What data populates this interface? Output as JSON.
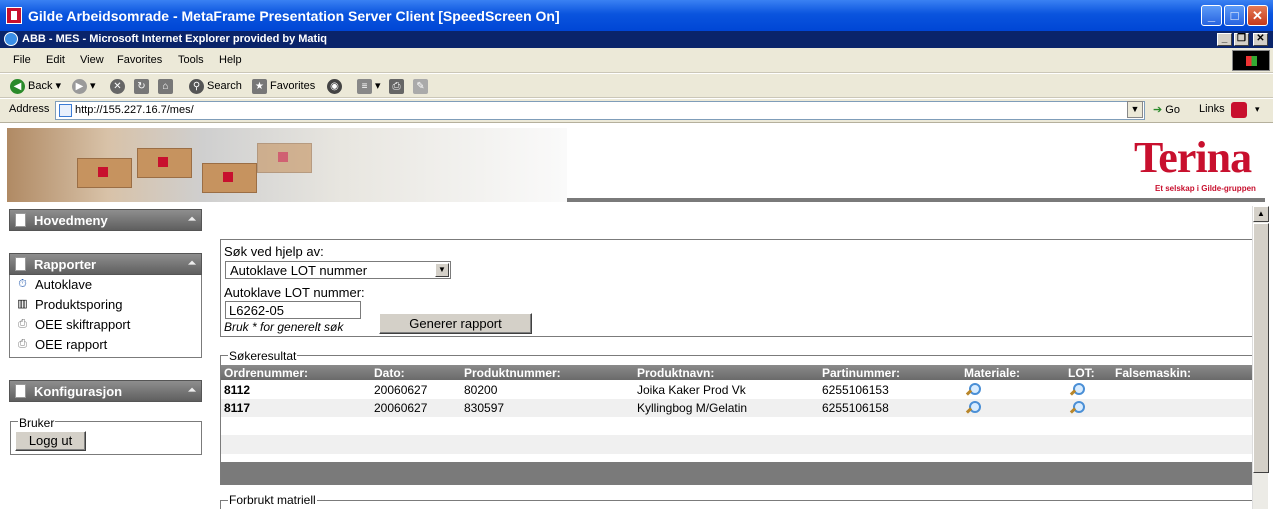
{
  "outer_window": {
    "title": "Gilde Arbeidsomrade - MetaFrame Presentation Server Client [SpeedScreen On]"
  },
  "browser": {
    "title": "ABB - MES - Microsoft Internet Explorer provided by Matiq",
    "menu": [
      "File",
      "Edit",
      "View",
      "Favorites",
      "Tools",
      "Help"
    ],
    "toolbar": {
      "back": "Back",
      "search": "Search",
      "favorites": "Favorites"
    },
    "address": {
      "label": "Address",
      "url": "http://155.227.16.7/mes/",
      "go": "Go",
      "links": "Links"
    }
  },
  "banner": {
    "logo_word": "Terina",
    "logo_tagline": "Et selskap i Gilde-gruppen"
  },
  "sidebar": {
    "hovedmeny": "Hovedmeny",
    "rapporter": {
      "title": "Rapporter",
      "items": [
        {
          "label": "Autoklave",
          "icon": "clock-icon"
        },
        {
          "label": "Produktsporing",
          "icon": "barcode-icon"
        },
        {
          "label": "OEE skiftrapport",
          "icon": "printer-icon"
        },
        {
          "label": "OEE rapport",
          "icon": "printer-icon"
        }
      ]
    },
    "konfigurasjon": "Konfigurasjon",
    "bruker": {
      "legend": "Bruker",
      "logout": "Logg ut"
    }
  },
  "search": {
    "criteria_label": "Søk ved hjelp av:",
    "criteria_value": "Autoklave LOT nummer",
    "lot_label": "Autoklave LOT nummer:",
    "lot_value": "L6262-05",
    "hint": "Bruk * for generelt søk",
    "generate_button": "Generer rapport"
  },
  "results": {
    "legend": "Søkeresultat",
    "columns": [
      "Ordrenummer:",
      "Dato:",
      "Produktnummer:",
      "Produktnavn:",
      "Partinummer:",
      "Materiale:",
      "LOT:",
      "Falsemaskin:"
    ],
    "rows": [
      {
        "ordre": "8112",
        "dato": "20060627",
        "produktnr": "80200",
        "produktnavn": "Joika Kaker Prod Vk",
        "parti": "6255106153"
      },
      {
        "ordre": "8117",
        "dato": "20060627",
        "produktnr": "830597",
        "produktnavn": "Kyllingbog M/Gelatin",
        "parti": "6255106158"
      }
    ]
  },
  "forbrukt": {
    "legend": "Forbrukt matriell"
  }
}
